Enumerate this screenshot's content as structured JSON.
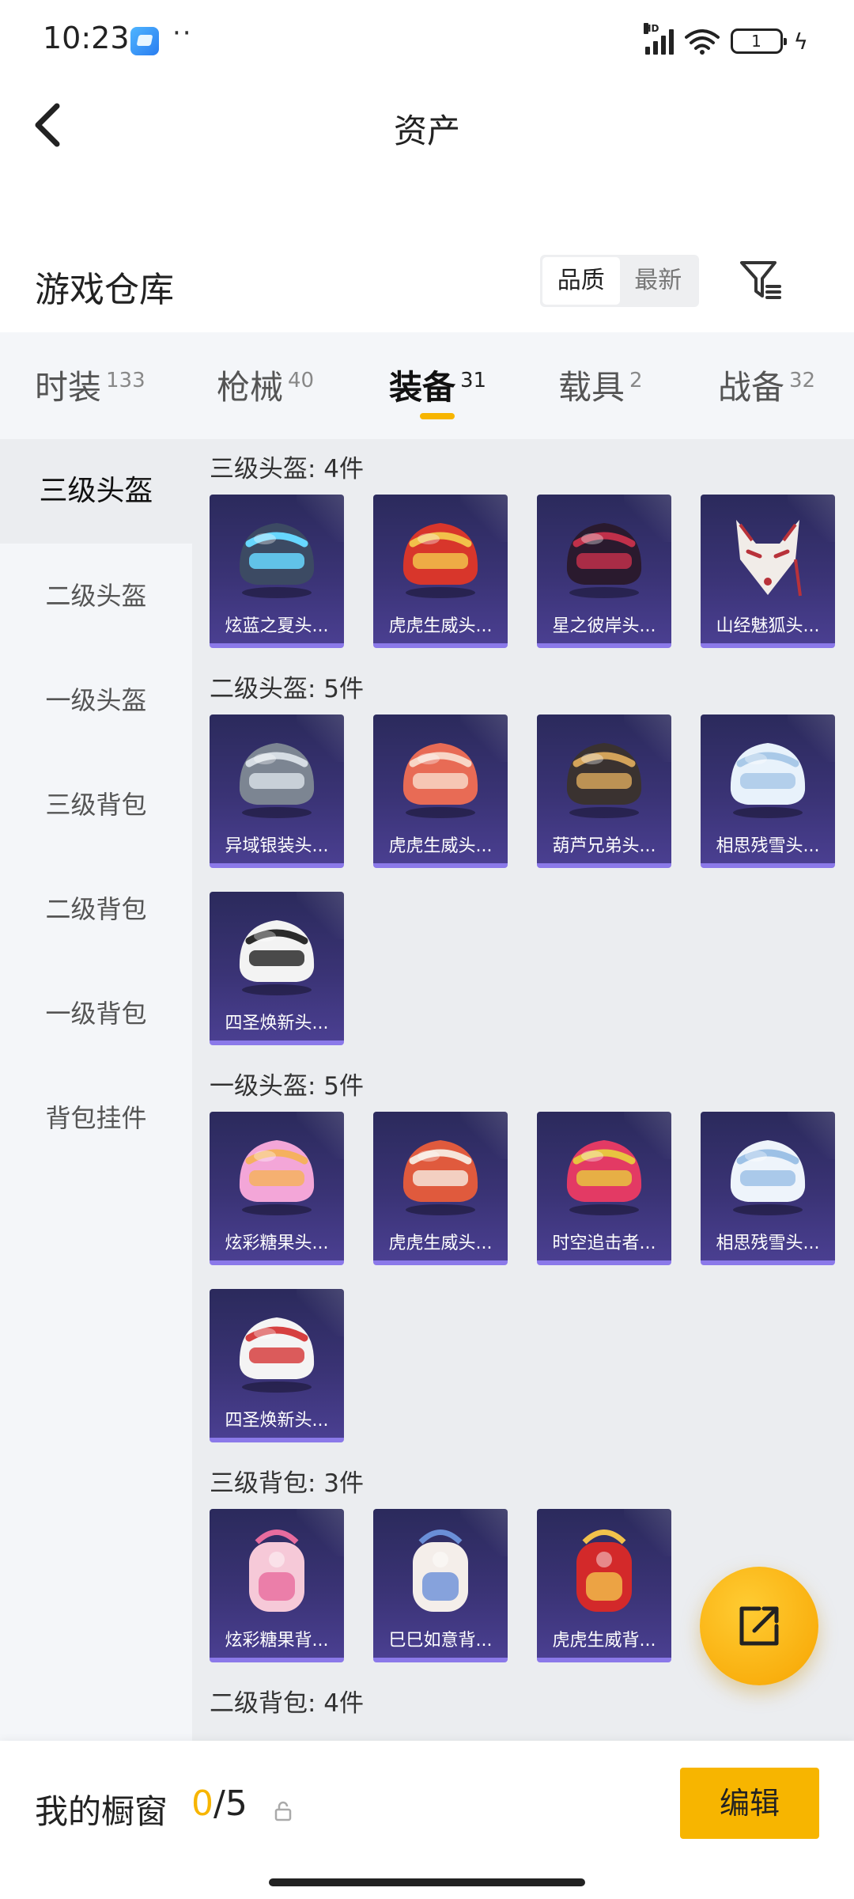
{
  "status_bar": {
    "time": "10:23",
    "dots": "··",
    "signal_label": "HD",
    "battery": "1"
  },
  "header": {
    "title": "资产"
  },
  "warehouse": {
    "title": "游戏仓库",
    "sort_options": [
      {
        "label": "品质",
        "active": true
      },
      {
        "label": "最新",
        "active": false
      }
    ]
  },
  "tabs": [
    {
      "label": "时装",
      "count": "133",
      "active": false
    },
    {
      "label": "枪械",
      "count": "40",
      "active": false
    },
    {
      "label": "装备",
      "count": "31",
      "active": true
    },
    {
      "label": "载具",
      "count": "2",
      "active": false
    },
    {
      "label": "战备",
      "count": "32",
      "active": false
    }
  ],
  "sidebar": [
    {
      "label": "三级头盔",
      "active": true
    },
    {
      "label": "二级头盔",
      "active": false
    },
    {
      "label": "一级头盔",
      "active": false
    },
    {
      "label": "三级背包",
      "active": false
    },
    {
      "label": "二级背包",
      "active": false
    },
    {
      "label": "一级背包",
      "active": false
    },
    {
      "label": "背包挂件",
      "active": false
    }
  ],
  "sections": [
    {
      "title": "三级头盔: 4件",
      "items": [
        {
          "name": "炫蓝之夏头...",
          "icon": "helmet-icon",
          "colors": [
            "#3c4a63",
            "#67d7ff"
          ]
        },
        {
          "name": "虎虎生威头...",
          "icon": "helmet-icon",
          "colors": [
            "#d8362b",
            "#f2c14a"
          ]
        },
        {
          "name": "星之彼岸头...",
          "icon": "helmet-icon",
          "colors": [
            "#2a1a2e",
            "#c0304a"
          ]
        },
        {
          "name": "山经魅狐头...",
          "icon": "fox-mask-icon",
          "colors": [
            "#f1ece8",
            "#b8323a"
          ]
        }
      ]
    },
    {
      "title": "二级头盔: 5件",
      "items": [
        {
          "name": "异域银装头...",
          "icon": "helmet-icon",
          "colors": [
            "#7c8592",
            "#d6dde4"
          ]
        },
        {
          "name": "虎虎生威头...",
          "icon": "helmet-icon",
          "colors": [
            "#e86b55",
            "#f8d6c6"
          ]
        },
        {
          "name": "葫芦兄弟头...",
          "icon": "helmet-icon",
          "colors": [
            "#3a3230",
            "#d3a35a"
          ]
        },
        {
          "name": "相思残雪头...",
          "icon": "helmet-icon",
          "colors": [
            "#e8f2fb",
            "#a9c9e8"
          ]
        },
        {
          "name": "四圣焕新头...",
          "icon": "helmet-icon",
          "colors": [
            "#f3f3f3",
            "#2b2b2b"
          ]
        }
      ]
    },
    {
      "title": "一级头盔: 5件",
      "items": [
        {
          "name": "炫彩糖果头...",
          "icon": "helmet-icon",
          "colors": [
            "#f3a6d8",
            "#f5b15f"
          ]
        },
        {
          "name": "虎虎生威头...",
          "icon": "helmet-icon",
          "colors": [
            "#e05a3d",
            "#f6e4d8"
          ]
        },
        {
          "name": "时空追击者...",
          "icon": "helmet-icon",
          "colors": [
            "#e33a64",
            "#e8c440"
          ]
        },
        {
          "name": "相思残雪头...",
          "icon": "helmet-icon",
          "colors": [
            "#eef4fb",
            "#9dc1e6"
          ]
        },
        {
          "name": "四圣焕新头...",
          "icon": "helmet-icon",
          "colors": [
            "#f4f4f4",
            "#d64040"
          ]
        }
      ]
    },
    {
      "title": "三级背包: 3件",
      "items": [
        {
          "name": "炫彩糖果背...",
          "icon": "backpack-icon",
          "colors": [
            "#f6c9d8",
            "#e86c9e"
          ]
        },
        {
          "name": "巳巳如意背...",
          "icon": "backpack-icon",
          "colors": [
            "#f4eeea",
            "#6a8fd8"
          ]
        },
        {
          "name": "虎虎生威背...",
          "icon": "backpack-icon",
          "colors": [
            "#d3292a",
            "#f2c24b"
          ]
        }
      ]
    },
    {
      "title": "二级背包: 4件",
      "items": []
    }
  ],
  "bottom": {
    "showcase_label": "我的橱窗",
    "used": "0",
    "total": "/5",
    "edit_label": "编辑"
  },
  "colors": {
    "accent": "#f7b500",
    "card_top": "#2b2a5c",
    "card_bottom": "#4a3f91",
    "card_border": "#8b79e9"
  }
}
